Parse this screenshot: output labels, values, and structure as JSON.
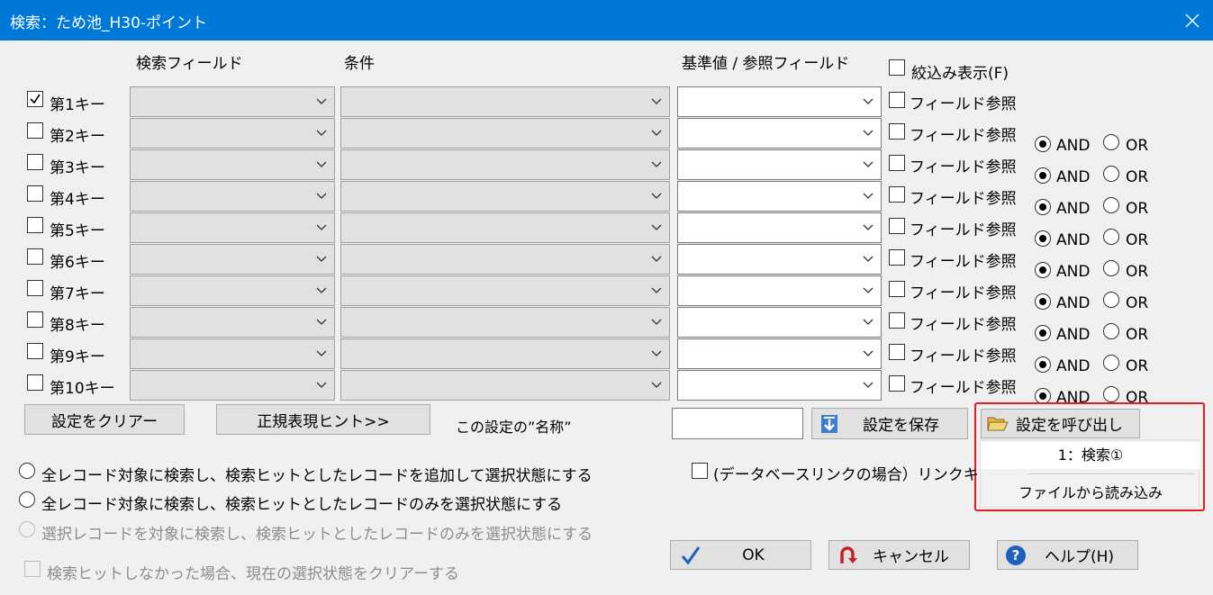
{
  "window": {
    "title": "検索：ため池_H30-ポイント"
  },
  "headers": {
    "field": "検索フィールド",
    "condition": "条件",
    "value": "基準値 / 参照フィールド"
  },
  "narrow_display": {
    "label": "絞込み表示(F)",
    "checked": false
  },
  "keys": [
    {
      "label": "第1キー",
      "checked": true,
      "field_ref": "フィールド参照"
    },
    {
      "label": "第2キー",
      "checked": false,
      "field_ref": "フィールド参照",
      "and": "AND",
      "or": "OR"
    },
    {
      "label": "第3キー",
      "checked": false,
      "field_ref": "フィールド参照",
      "and": "AND",
      "or": "OR"
    },
    {
      "label": "第4キー",
      "checked": false,
      "field_ref": "フィールド参照",
      "and": "AND",
      "or": "OR"
    },
    {
      "label": "第5キー",
      "checked": false,
      "field_ref": "フィールド参照",
      "and": "AND",
      "or": "OR"
    },
    {
      "label": "第6キー",
      "checked": false,
      "field_ref": "フィールド参照",
      "and": "AND",
      "or": "OR"
    },
    {
      "label": "第7キー",
      "checked": false,
      "field_ref": "フィールド参照",
      "and": "AND",
      "or": "OR"
    },
    {
      "label": "第8キー",
      "checked": false,
      "field_ref": "フィールド参照",
      "and": "AND",
      "or": "OR"
    },
    {
      "label": "第9キー",
      "checked": false,
      "field_ref": "フィールド参照",
      "and": "AND",
      "or": "OR"
    },
    {
      "label": "第10キー",
      "checked": false,
      "field_ref": "フィールド参照",
      "and": "AND",
      "or": "OR"
    }
  ],
  "buttons": {
    "clear": "設定をクリアー",
    "regex_hint": "正規表現ヒント>>",
    "save": "設定を保存",
    "load": "設定を呼び出し",
    "ok": "OK",
    "cancel": "キャンセル",
    "help": "ヘルプ(H)"
  },
  "setting_name_label": "この設定の”名称”",
  "setting_name_value": "",
  "load_menu": {
    "items": [
      "1：検索①",
      "ファイルから読み込み"
    ]
  },
  "db_link": {
    "label": "(データベースリンクの場合）リンクキー",
    "checked": false
  },
  "modes": [
    {
      "label": "全レコード対象に検索し、検索ヒットとしたレコードを追加して選択状態にする",
      "selected": false,
      "enabled": true
    },
    {
      "label": "全レコード対象に検索し、検索ヒットとしたレコードのみを選択状態にする",
      "selected": false,
      "enabled": true
    },
    {
      "label": "選択レコードを対象に検索し、検索ヒットとしたレコードのみを選択状態にする",
      "selected": false,
      "enabled": false
    }
  ],
  "clear_on_no_hit": {
    "label": "検索ヒットしなかった場合、現在の選択状態をクリアーする",
    "checked": false,
    "enabled": false
  }
}
